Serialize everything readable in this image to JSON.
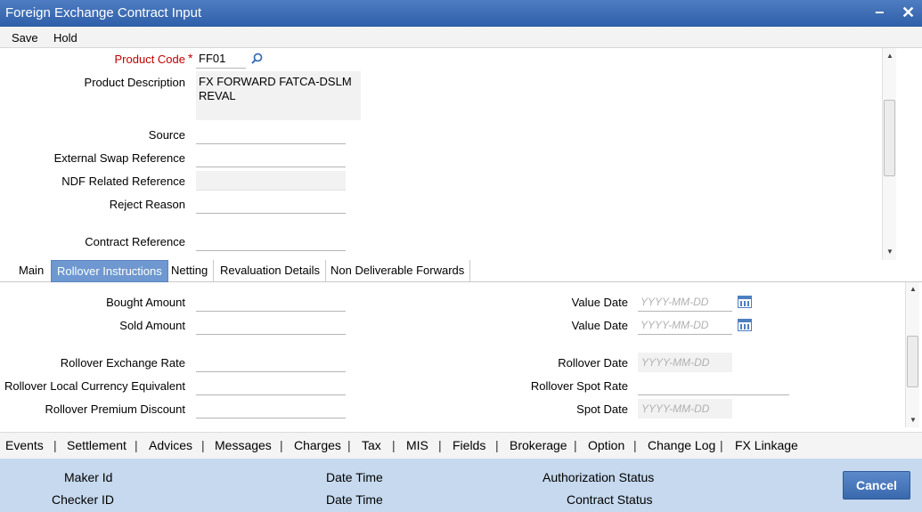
{
  "window": {
    "title": "Foreign Exchange Contract Input",
    "minimize": "−",
    "close": "✕"
  },
  "menu": {
    "save": "Save",
    "hold": "Hold"
  },
  "header": {
    "product_code_label": "Product Code",
    "required_mark": "*",
    "product_code_value": "FF01",
    "product_description_label": "Product Description",
    "product_description_line1": "FX FORWARD FATCA-DSLM",
    "product_description_line2": "REVAL",
    "source_label": "Source",
    "external_swap_label": "External Swap Reference",
    "ndf_label": "NDF Related Reference",
    "reject_reason_label": "Reject Reason",
    "contract_reference_label": "Contract Reference"
  },
  "tabs": [
    "Main",
    "Rollover Instructions",
    "Netting",
    "Revaluation Details",
    "Non Deliverable Forwards"
  ],
  "active_tab": "Rollover Instructions",
  "rollover": {
    "bought_amount_label": "Bought Amount",
    "sold_amount_label": "Sold Amount",
    "rollover_exchange_rate_label": "Rollover Exchange Rate",
    "rollover_lce_label": "Rollover Local Currency Equivalent",
    "rollover_premium_label": "Rollover Premium Discount",
    "value_date_label_1": "Value Date",
    "value_date_label_2": "Value Date",
    "rollover_date_label": "Rollover Date",
    "rollover_spot_rate_label": "Rollover Spot Rate",
    "spot_date_label": "Spot Date",
    "date_placeholder": "YYYY-MM-DD"
  },
  "footer_links": [
    "Events",
    "Settlement",
    "Advices",
    "Messages",
    "Charges",
    "Tax",
    "MIS",
    "Fields",
    "Brokerage",
    "Option",
    "Change Log",
    "FX Linkage"
  ],
  "footer_separator": "|",
  "status": {
    "maker_id": "Maker Id",
    "checker_id": "Checker ID",
    "date_time_1": "Date Time",
    "date_time_2": "Date Time",
    "authorization_status": "Authorization Status",
    "contract_status": "Contract Status"
  },
  "cancel_label": "Cancel",
  "icons": {
    "search": "search-icon",
    "calendar": "calendar-icon"
  },
  "colors": {
    "title_bar": "#3a6cb4",
    "active_tab": "#6e98cf",
    "status_bar": "#c6d9ee",
    "required": "#c00000",
    "cancel_button": "#4a79bd"
  }
}
